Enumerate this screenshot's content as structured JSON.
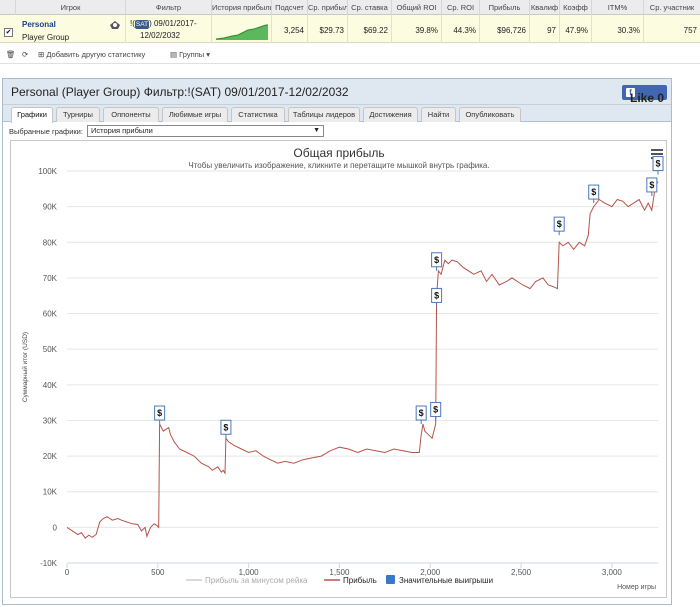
{
  "table": {
    "headers": [
      "Игрок",
      "Фильтр",
      "История прибыли",
      "Подсчет",
      "Ср. прибыль",
      "Ср. ставка",
      "Общий ROI",
      "Ср. ROI",
      "Прибыль",
      "Квалиф",
      "Коэфф",
      "ITM%",
      "Ср. участник"
    ],
    "row": {
      "player_name": "Personal",
      "player_group": "Player Group",
      "filter_prefix": "!(",
      "filter_badge": "SAT",
      "filter_line1": ") 09/01/2017-",
      "filter_line2": "12/02/2032",
      "count": "3,254",
      "avg_profit": "$29.73",
      "avg_buyin": "$69.22",
      "total_roi": "39.8%",
      "avg_roi": "44.3%",
      "profit": "$96,726",
      "qualify": "97",
      "ratio": "47.9%",
      "itm": "30.3%",
      "avg_participants": "757"
    }
  },
  "toolbar": {
    "add_stat": "Добавить другую статистику",
    "groups": "Группы"
  },
  "panel": {
    "title": "Personal (Player Group) Фильтр:!(SAT) 09/01/2017-12/02/2032",
    "like": "Like 0",
    "tabs": [
      "Графики",
      "Турниры",
      "Оппоненты",
      "Любимые игры",
      "Статистика",
      "Таблицы лидеров",
      "Достижения",
      "Найти",
      "Опубликовать"
    ],
    "active_tab": 0,
    "select_label": "Выбранные графики:",
    "select_value": "История прибыли"
  },
  "chart_data": {
    "type": "line",
    "title": "Общая прибыль",
    "subtitle": "Чтобы увеличить изображение, кликните и перетащите мышкой внутрь графика.",
    "xlabel": "Номер игры",
    "ylabel": "Суммарный итог (USD)",
    "xlim": [
      0,
      3254
    ],
    "ylim": [
      -10000,
      100000
    ],
    "x_ticks": [
      "0",
      "500",
      "1,000",
      "1,500",
      "2,000",
      "2,500",
      "3,000"
    ],
    "y_ticks": [
      "-10K",
      "0",
      "10K",
      "20K",
      "30K",
      "40K",
      "50K",
      "60K",
      "70K",
      "80K",
      "90K",
      "100K"
    ],
    "legend": [
      "Прибыль за минусом рейка",
      "Прибыль",
      "Значительные выигрыши"
    ],
    "legend_position": "bottom",
    "series": [
      {
        "name": "Прибыль",
        "color": "#b5544a",
        "points": [
          [
            0,
            0
          ],
          [
            30,
            -1000
          ],
          [
            60,
            -2000
          ],
          [
            80,
            -1500
          ],
          [
            100,
            -3000
          ],
          [
            120,
            -2200
          ],
          [
            140,
            -2800
          ],
          [
            160,
            -2000
          ],
          [
            180,
            1500
          ],
          [
            200,
            2500
          ],
          [
            220,
            3000
          ],
          [
            250,
            2000
          ],
          [
            280,
            2500
          ],
          [
            300,
            2000
          ],
          [
            330,
            1500
          ],
          [
            360,
            1000
          ],
          [
            390,
            800
          ],
          [
            410,
            -1000
          ],
          [
            430,
            0
          ],
          [
            440,
            -2500
          ],
          [
            460,
            0
          ],
          [
            480,
            1000
          ],
          [
            495,
            500
          ],
          [
            505,
            0
          ],
          [
            510,
            29000
          ],
          [
            530,
            27000
          ],
          [
            560,
            28000
          ],
          [
            570,
            26000
          ],
          [
            590,
            24000
          ],
          [
            620,
            22000
          ],
          [
            660,
            21000
          ],
          [
            700,
            20000
          ],
          [
            740,
            18000
          ],
          [
            780,
            17000
          ],
          [
            800,
            16000
          ],
          [
            830,
            17000
          ],
          [
            850,
            15500
          ],
          [
            860,
            16000
          ],
          [
            870,
            15200
          ],
          [
            875,
            25000
          ],
          [
            890,
            24000
          ],
          [
            920,
            23000
          ],
          [
            960,
            22000
          ],
          [
            1000,
            21000
          ],
          [
            1040,
            21500
          ],
          [
            1080,
            20000
          ],
          [
            1120,
            19000
          ],
          [
            1160,
            18000
          ],
          [
            1200,
            18500
          ],
          [
            1250,
            18000
          ],
          [
            1300,
            19000
          ],
          [
            1350,
            19500
          ],
          [
            1400,
            20000
          ],
          [
            1450,
            21500
          ],
          [
            1500,
            22500
          ],
          [
            1550,
            22000
          ],
          [
            1600,
            21000
          ],
          [
            1650,
            22000
          ],
          [
            1700,
            21500
          ],
          [
            1750,
            21000
          ],
          [
            1800,
            22000
          ],
          [
            1850,
            21500
          ],
          [
            1900,
            21000
          ],
          [
            1940,
            21000
          ],
          [
            1950,
            26000
          ],
          [
            1960,
            29000
          ],
          [
            1970,
            27000
          ],
          [
            1990,
            26000
          ],
          [
            2010,
            25000
          ],
          [
            2020,
            27000
          ],
          [
            2030,
            29000
          ],
          [
            2035,
            65000
          ],
          [
            2045,
            72000
          ],
          [
            2060,
            71000
          ],
          [
            2080,
            75000
          ],
          [
            2100,
            74000
          ],
          [
            2120,
            75000
          ],
          [
            2150,
            74500
          ],
          [
            2180,
            73000
          ],
          [
            2210,
            72000
          ],
          [
            2240,
            71000
          ],
          [
            2280,
            72000
          ],
          [
            2310,
            69000
          ],
          [
            2340,
            71000
          ],
          [
            2380,
            68000
          ],
          [
            2420,
            69000
          ],
          [
            2450,
            70000
          ],
          [
            2480,
            69000
          ],
          [
            2510,
            68000
          ],
          [
            2550,
            67000
          ],
          [
            2580,
            69000
          ],
          [
            2620,
            70000
          ],
          [
            2650,
            68000
          ],
          [
            2680,
            67500
          ],
          [
            2700,
            67000
          ],
          [
            2710,
            80000
          ],
          [
            2730,
            79000
          ],
          [
            2760,
            80000
          ],
          [
            2790,
            78000
          ],
          [
            2820,
            80000
          ],
          [
            2850,
            79000
          ],
          [
            2870,
            82000
          ],
          [
            2880,
            88000
          ],
          [
            2900,
            90000
          ],
          [
            2930,
            92000
          ],
          [
            2960,
            91000
          ],
          [
            3000,
            90000
          ],
          [
            3030,
            92000
          ],
          [
            3060,
            91500
          ],
          [
            3090,
            90000
          ],
          [
            3120,
            91000
          ],
          [
            3150,
            92000
          ],
          [
            3170,
            90000
          ],
          [
            3180,
            89000
          ],
          [
            3200,
            91000
          ],
          [
            3220,
            89000
          ],
          [
            3240,
            96000
          ],
          [
            3254,
            97000
          ]
        ]
      }
    ],
    "big_wins": [
      [
        510,
        29000
      ],
      [
        875,
        25000
      ],
      [
        1950,
        29000
      ],
      [
        2030,
        30000
      ],
      [
        2035,
        62000
      ],
      [
        2035,
        72000
      ],
      [
        2710,
        82000
      ],
      [
        2900,
        91000
      ],
      [
        3220,
        93000
      ],
      [
        3254,
        99000
      ]
    ]
  }
}
